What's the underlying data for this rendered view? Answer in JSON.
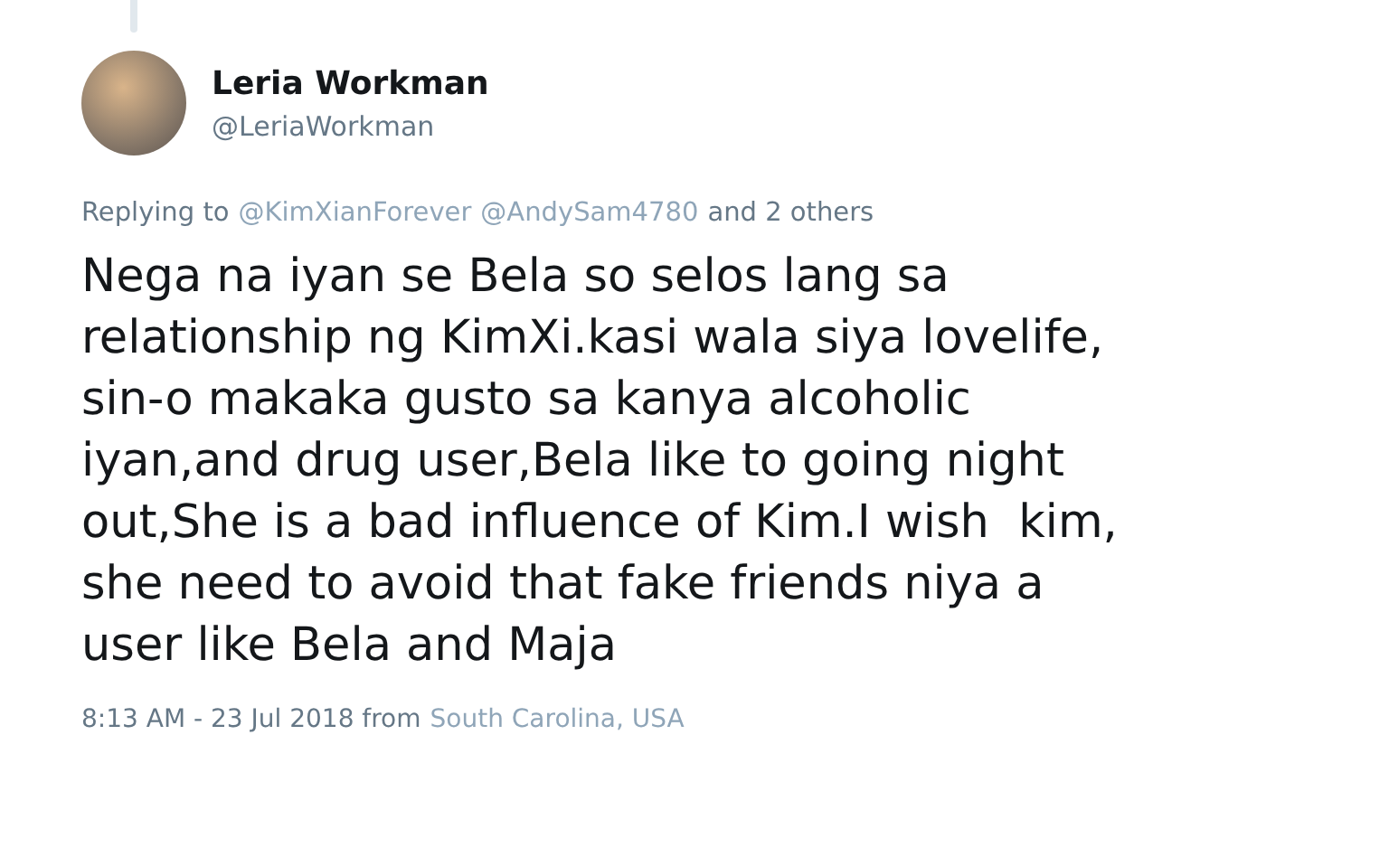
{
  "author": {
    "name": "Leria Workman",
    "handle": "@LeriaWorkman"
  },
  "reply": {
    "prefix": "Replying to",
    "mentions": [
      "@KimXianForever",
      "@AndySam4780"
    ],
    "suffix": "and 2 others"
  },
  "body_lines": [
    "Nega na iyan se Bela so selos lang sa",
    "relationship ng KimXi.kasi wala siya lovelife,",
    "sin-o makaka gusto sa kanya alcoholic",
    "iyan,and drug user,Bela like to going night",
    "out,She is a bad influence of Kim.I wish  kim,",
    "she need to avoid that fake friends niya a",
    "user like Bela and Maja"
  ],
  "footer": {
    "timestamp": "8:13 AM - 23 Jul 2018 from",
    "location": "South Carolina, USA"
  }
}
